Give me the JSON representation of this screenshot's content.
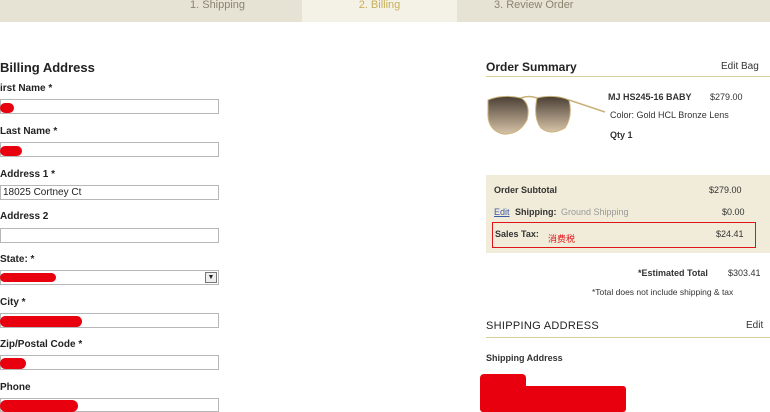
{
  "steps": [
    {
      "label": "1. Shipping"
    },
    {
      "label": "2. Billing"
    },
    {
      "label": "3. Review Order"
    }
  ],
  "billing": {
    "title": "Billing Address",
    "first_name_label": "irst Name *",
    "last_name_label": "Last Name *",
    "address1_label": "Address 1 *",
    "address1_value": "18025 Cortney Ct",
    "address2_label": "Address 2",
    "state_label": "State: *",
    "city_label": "City *",
    "zip_label": "Zip/Postal Code *",
    "phone_label": "Phone"
  },
  "order_summary": {
    "title": "Order Summary",
    "edit_bag": "Edit Bag",
    "product_name": "MJ HS245-16 BABY",
    "product_price": "$279.00",
    "color_text": "Color: Gold HCL Bronze Lens",
    "qty_text": "Qty 1",
    "subtotal_label": "Order Subtotal",
    "subtotal_value": "$279.00",
    "edit_link": "Edit",
    "shipping_label": "Shipping:",
    "shipping_method": "Ground Shipping",
    "shipping_value": "$0.00",
    "sales_tax_label": "Sales Tax:",
    "sales_tax_note": "消费税",
    "sales_tax_value": "$24.41",
    "estimated_total_label": "*Estimated Total",
    "estimated_total_value": "$303.41",
    "total_note": "*Total does not include shipping & tax"
  },
  "shipping_address": {
    "title": "SHIPPING ADDRESS",
    "edit": "Edit",
    "label": "Shipping Address"
  },
  "colors": {
    "accent_gold": "#c7b05a",
    "redaction": "#e8000e",
    "summary_bg": "#f0ecd9",
    "link_blue": "#3b5aa5"
  }
}
